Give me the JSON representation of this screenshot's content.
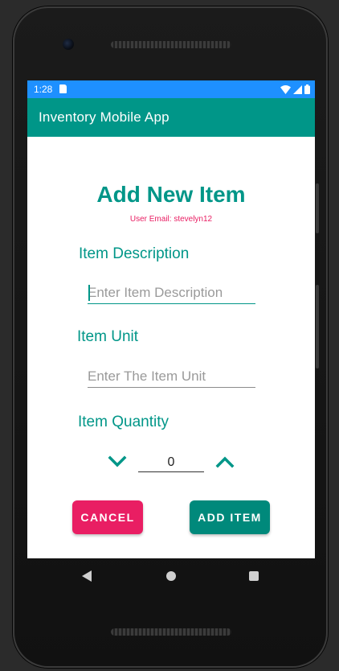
{
  "status_bar": {
    "time": "1:28",
    "color": "#1e90ff"
  },
  "app_bar": {
    "title": "Inventory Mobile App",
    "color": "#009688"
  },
  "form": {
    "heading": "Add New Item",
    "user_email": "User Email: stevelyn12",
    "description": {
      "label": "Item Description",
      "placeholder": "Enter Item Description",
      "value": ""
    },
    "unit": {
      "label": "Item Unit",
      "placeholder": "Enter The Item Unit",
      "value": ""
    },
    "quantity": {
      "label": "Item Quantity",
      "value": "0",
      "decrease_icon": "chevron-down-icon",
      "increase_icon": "chevron-up-icon"
    },
    "buttons": {
      "cancel_label": "CANCEL",
      "cancel_color": "#e91e63",
      "add_label": "ADD ITEM",
      "add_color": "#00897b"
    }
  },
  "nav_bar": {
    "back_icon": "back-triangle-icon",
    "home_icon": "home-circle-icon",
    "recents_icon": "recents-square-icon"
  }
}
